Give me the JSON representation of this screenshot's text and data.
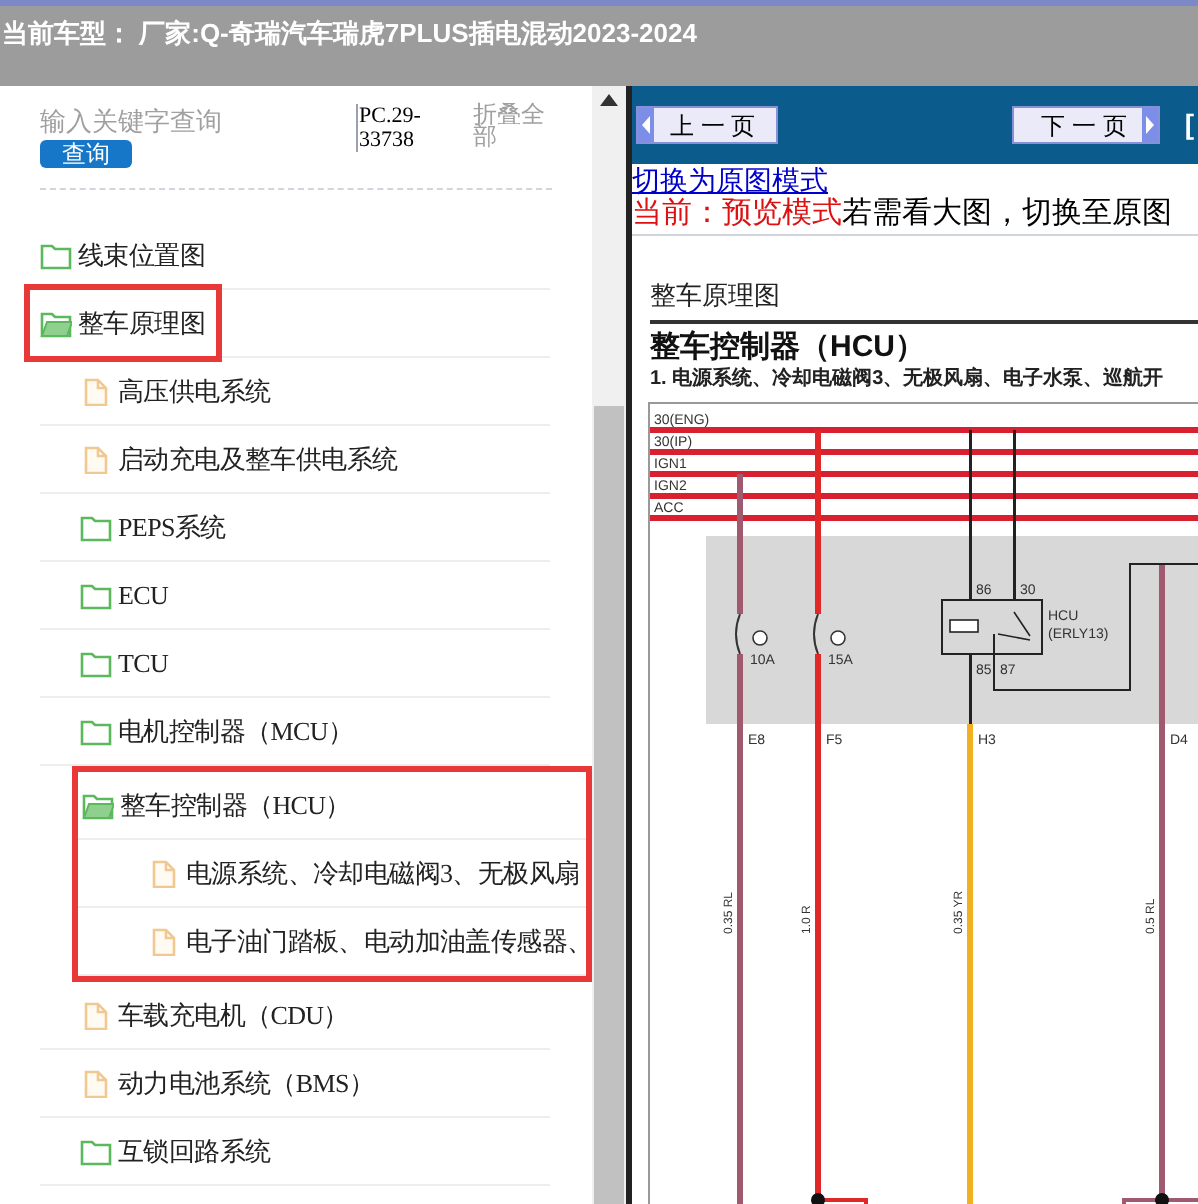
{
  "header": {
    "title": "当前车型： 厂家:Q-奇瑞汽车瑞虎7PLUS插电混动2023-2024"
  },
  "search": {
    "placeholder": "输入关键字查询",
    "button": "查询",
    "code": "PC.29-33738",
    "collapse": "折叠全部"
  },
  "tree": [
    {
      "label": "线束位置图",
      "kind": "folder",
      "expanded": false,
      "boxed": false,
      "group_boxed": false
    },
    {
      "label": "整车原理图",
      "kind": "folder",
      "expanded": true,
      "boxed": true,
      "group_boxed": false,
      "children": [
        {
          "label": "高压供电系统",
          "kind": "file",
          "boxed": false,
          "group_boxed": false
        },
        {
          "label": "启动充电及整车供电系统",
          "kind": "file",
          "boxed": false,
          "group_boxed": false
        },
        {
          "label": "PEPS系统",
          "kind": "folder",
          "expanded": false,
          "boxed": false,
          "group_boxed": false
        },
        {
          "label": "ECU",
          "kind": "folder",
          "expanded": false,
          "boxed": false,
          "group_boxed": false
        },
        {
          "label": "TCU",
          "kind": "folder",
          "expanded": false,
          "boxed": false,
          "group_boxed": false
        },
        {
          "label": "电机控制器（MCU）",
          "kind": "folder",
          "expanded": false,
          "boxed": false,
          "group_boxed": false
        },
        {
          "label": "整车控制器（HCU）",
          "kind": "folder",
          "expanded": true,
          "boxed": false,
          "group_boxed": true,
          "children": [
            {
              "label": "电源系统、冷却电磁阀3、无极风扇",
              "kind": "file",
              "boxed": false,
              "group_boxed": false
            },
            {
              "label": "电子油门踏板、电动加油盖传感器、",
              "kind": "file",
              "boxed": false,
              "group_boxed": false
            }
          ]
        },
        {
          "label": "车载充电机（CDU）",
          "kind": "file",
          "boxed": false,
          "group_boxed": false
        },
        {
          "label": "动力电池系统（BMS）",
          "kind": "file",
          "boxed": false,
          "group_boxed": false
        },
        {
          "label": "互锁回路系统",
          "kind": "folder",
          "expanded": false,
          "boxed": false,
          "group_boxed": false
        }
      ]
    }
  ],
  "viewer": {
    "prev": "上 一 页",
    "next": "下 一 页",
    "cut_link": "[",
    "mode_link": "切换为原图模式",
    "mode_label": "当前：预览模式",
    "mode_hint": "若需看大图，切换至原图",
    "doc": {
      "section": "整车原理图",
      "title": "整车控制器（HCU）",
      "subtitle": "1. 电源系统、冷却电磁阀3、无极风扇、电子水泵、巡航开",
      "buses": [
        "30(ENG)",
        "30(IP)",
        "IGN1",
        "IGN2",
        "ACC"
      ],
      "fuses": [
        "10A",
        "15A"
      ],
      "relay": {
        "pins": [
          "86",
          "30",
          "85",
          "87"
        ],
        "name": "HCU",
        "code": "(ERLY13)"
      },
      "wires": [
        {
          "connector": "E8",
          "label": "0.35 RL",
          "color": "#a05a70"
        },
        {
          "connector": "F5",
          "label": "1.0 R",
          "color": "#e02828"
        },
        {
          "connector": "H3",
          "label": "0.35 YR",
          "color": "#f0b020"
        },
        {
          "connector": "D4",
          "label": "0.5 RL",
          "color": "#a05a70"
        }
      ]
    }
  }
}
